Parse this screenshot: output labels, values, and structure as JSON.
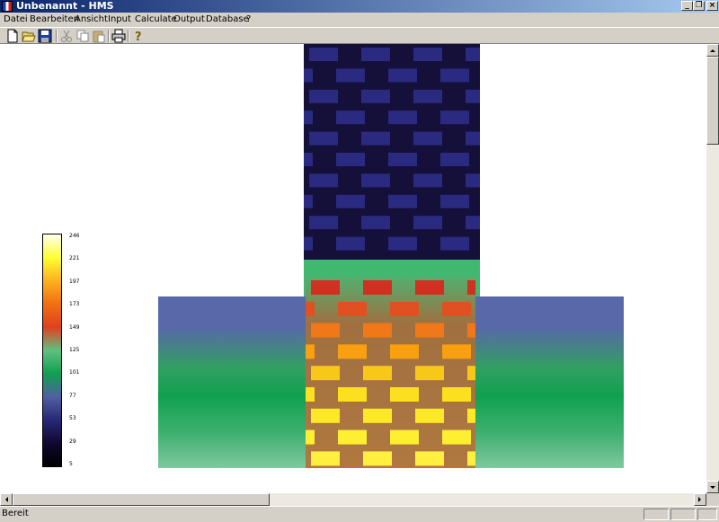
{
  "window": {
    "title": "Unbenannt - HMS",
    "controls": {
      "minimize": "_",
      "restore": "❐",
      "close": "×"
    }
  },
  "menu": [
    {
      "label": "Datei",
      "mnemonic": "D"
    },
    {
      "label": "Bearbeiten",
      "mnemonic": "B"
    },
    {
      "label": "Ansicht",
      "mnemonic": "A"
    },
    {
      "label": "Input",
      "mnemonic": "I"
    },
    {
      "label": "Calculate",
      "mnemonic": ""
    },
    {
      "label": "Output",
      "mnemonic": ""
    },
    {
      "label": "Database",
      "mnemonic": ""
    },
    {
      "label": "?",
      "mnemonic": "?"
    }
  ],
  "toolbar": {
    "buttons": [
      {
        "name": "new-file-button",
        "icon": "new-file-icon"
      },
      {
        "name": "open-button",
        "icon": "open-folder-icon"
      },
      {
        "name": "save-button",
        "icon": "save-icon"
      },
      {
        "name": "cut-button",
        "icon": "cut-icon"
      },
      {
        "name": "copy-button",
        "icon": "copy-icon"
      },
      {
        "name": "paste-button",
        "icon": "paste-icon"
      },
      {
        "name": "print-button",
        "icon": "print-icon"
      },
      {
        "name": "help-button",
        "icon": "help-icon"
      }
    ]
  },
  "legend": {
    "ticks": [
      "246",
      "221",
      "197",
      "173",
      "149",
      "125",
      "101",
      "77",
      "53",
      "29",
      "5"
    ],
    "colors": [
      "#fffff0",
      "#ffff30",
      "#ffb020",
      "#f07010",
      "#e04020",
      "#60c080",
      "#10a050",
      "#5060a0",
      "#282878",
      "#100830",
      "#000000"
    ]
  },
  "status": {
    "text": "Bereit"
  },
  "scroll": {
    "vertical_position": 0.04,
    "horizontal_position": 0.0
  }
}
